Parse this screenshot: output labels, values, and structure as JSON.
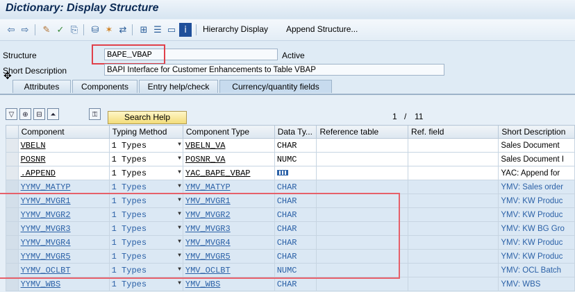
{
  "title": "Dictionary: Display Structure",
  "toolbar": {
    "hierarchy_display": "Hierarchy Display",
    "append_structure": "Append Structure..."
  },
  "header": {
    "structure_label": "Structure",
    "structure_value": "BAPE_VBAP",
    "status": "Active",
    "short_desc_label": "Short Description",
    "short_desc_value": "BAPI Interface for Customer Enhancements to Table VBAP"
  },
  "tabs": [
    "Attributes",
    "Components",
    "Entry help/check",
    "Currency/quantity fields"
  ],
  "active_tab": "Currency/quantity fields",
  "grid": {
    "search_help": "Search Help",
    "pager_current": "1",
    "pager_sep": "/",
    "pager_total": "11",
    "columns": [
      "Component",
      "Typing Method",
      "Component Type",
      "Data Ty...",
      "Reference table",
      "Ref. field",
      "Short Description"
    ],
    "rows": [
      {
        "component": "VBELN",
        "typing": "1 Types",
        "ctype": "VBELN_VA",
        "dtype": "CHAR",
        "desc": "Sales Document"
      },
      {
        "component": "POSNR",
        "typing": "1 Types",
        "ctype": "POSNR_VA",
        "dtype": "NUMC",
        "desc": "Sales Document I"
      },
      {
        "component": ".APPEND",
        "typing": "1 Types",
        "ctype": "YAC_BAPE_VBAP",
        "dtype": "",
        "desc": "YAC: Append for"
      },
      {
        "component": "YYMV_MATYP",
        "typing": "1 Types",
        "ctype": "YMV_MATYP",
        "dtype": "CHAR",
        "desc": "YMV: Sales order"
      },
      {
        "component": "YYMV_MVGR1",
        "typing": "1 Types",
        "ctype": "YMV_MVGR1",
        "dtype": "CHAR",
        "desc": "YMV: KW Produc"
      },
      {
        "component": "YYMV_MVGR2",
        "typing": "1 Types",
        "ctype": "YMV_MVGR2",
        "dtype": "CHAR",
        "desc": "YMV: KW Produc"
      },
      {
        "component": "YYMV_MVGR3",
        "typing": "1 Types",
        "ctype": "YMV_MVGR3",
        "dtype": "CHAR",
        "desc": "YMV: KW BG Gro"
      },
      {
        "component": "YYMV_MVGR4",
        "typing": "1 Types",
        "ctype": "YMV_MVGR4",
        "dtype": "CHAR",
        "desc": "YMV: KW Produc"
      },
      {
        "component": "YYMV_MVGR5",
        "typing": "1 Types",
        "ctype": "YMV_MVGR5",
        "dtype": "CHAR",
        "desc": "YMV: KW Produc"
      },
      {
        "component": "YYMV_OCLBT",
        "typing": "1 Types",
        "ctype": "YMV_OCLBT",
        "dtype": "NUMC",
        "desc": "YMV: OCL Batch"
      },
      {
        "component": "YYMV_WBS",
        "typing": "1 Types",
        "ctype": "YMV_WBS",
        "dtype": "CHAR",
        "desc": "YMV: WBS"
      }
    ]
  },
  "colors": {
    "highlight": "#e0404a",
    "append_text": "#2b61a7",
    "search_btn": "#f3dd7a"
  }
}
